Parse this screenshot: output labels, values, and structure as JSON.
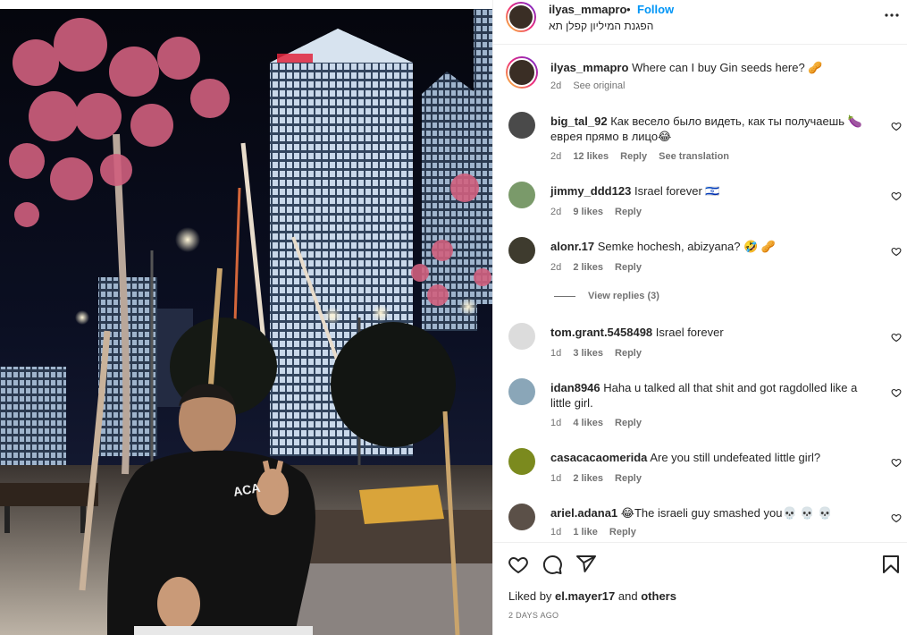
{
  "header": {
    "username": "ilyas_mmapro",
    "separator": "•",
    "follow_label": "Follow",
    "location": "הפגנת המיליון קפלן תא"
  },
  "caption": {
    "username": "ilyas_mmapro",
    "text": "Where can I buy Gin seeds here? 🥜",
    "age": "2d",
    "see_original": "See original"
  },
  "comments": [
    {
      "username": "big_tal_92",
      "text": "Как весело было видеть, как ты получаешь 🍆 еврея прямо в лицо😂",
      "age": "2d",
      "likes": "12 likes",
      "reply": "Reply",
      "extra": "See translation",
      "avatar_color": "#4a4a4a"
    },
    {
      "username": "jimmy_ddd123",
      "text": "Israel forever 🇮🇱",
      "age": "2d",
      "likes": "9 likes",
      "reply": "Reply",
      "extra": "",
      "avatar_color": "#7a9a6a"
    },
    {
      "username": "alonr.17",
      "text": "Semke hochesh, abizyana? 🤣 🥜",
      "age": "2d",
      "likes": "2 likes",
      "reply": "Reply",
      "extra": "",
      "avatar_color": "#3e3b2e"
    },
    {
      "username": "tom.grant.5458498",
      "text": "Israel forever",
      "age": "1d",
      "likes": "3 likes",
      "reply": "Reply",
      "extra": "",
      "avatar_color": "#dcdcdc"
    },
    {
      "username": "idan8946",
      "text": "Haha u talked all that shit and got ragdolled like a little girl.",
      "age": "1d",
      "likes": "4 likes",
      "reply": "Reply",
      "extra": "",
      "avatar_color": "#8aa6b8"
    },
    {
      "username": "casacacaomerida",
      "text": "Are you still undefeated little girl?",
      "age": "1d",
      "likes": "2 likes",
      "reply": "Reply",
      "extra": "",
      "avatar_color": "#7b8a1e"
    },
    {
      "username": "ariel.adana1",
      "text": "😂The israeli guy smashed you💀 💀 💀",
      "age": "1d",
      "likes": "1 like",
      "reply": "Reply",
      "extra": "",
      "avatar_color": "#5b5048"
    }
  ],
  "view_replies": "View replies (3)",
  "footer": {
    "liked_prefix": "Liked by",
    "liked_user": "el.mayer17",
    "liked_and": "and",
    "liked_others": "others",
    "date": "2 DAYS AGO"
  },
  "icons": {
    "more": "more-options-icon",
    "like": "heart-icon",
    "comment": "comment-icon",
    "share": "send-icon",
    "save": "bookmark-icon"
  },
  "colors": {
    "accent": "#0095f6",
    "text": "#262626",
    "muted": "#737373"
  }
}
